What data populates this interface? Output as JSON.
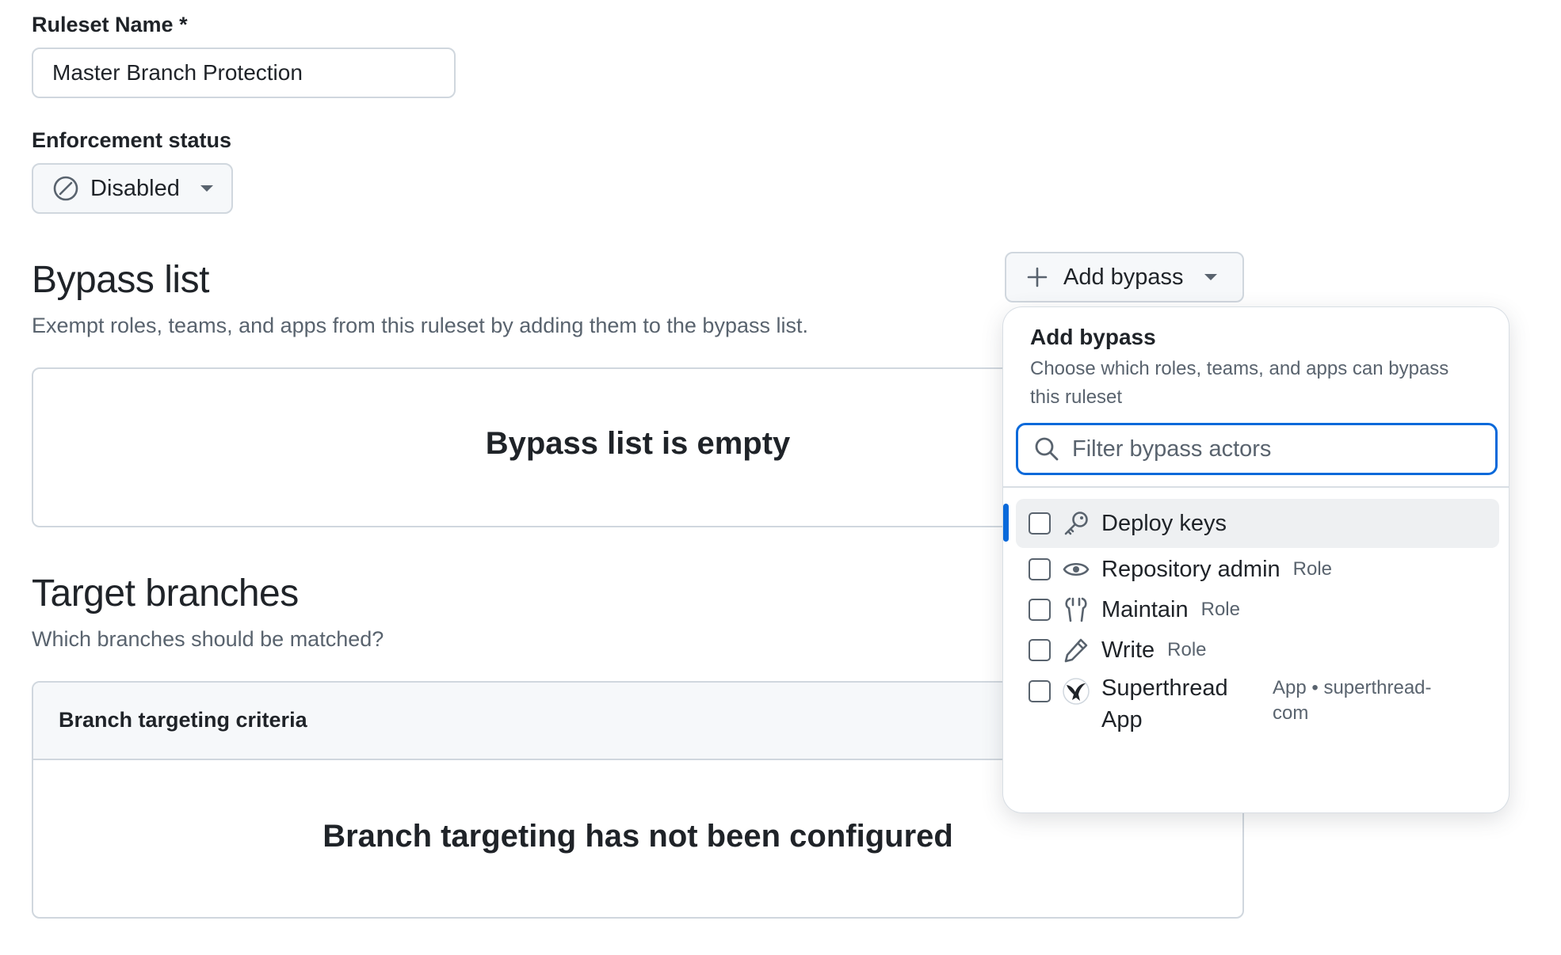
{
  "ruleset": {
    "name_label": "Ruleset Name *",
    "name_value": "Master Branch Protection"
  },
  "enforcement": {
    "label": "Enforcement status",
    "value": "Disabled"
  },
  "bypass": {
    "title": "Bypass list",
    "description": "Exempt roles, teams, and apps from this ruleset by adding them to the bypass list.",
    "add_button_label": "Add bypass",
    "empty_text": "Bypass list is empty"
  },
  "target": {
    "title": "Target branches",
    "description": "Which branches should be matched?",
    "criteria_header": "Branch targeting criteria",
    "empty_text": "Branch targeting has not been configured"
  },
  "popover": {
    "title": "Add bypass",
    "description": "Choose which roles, teams, and apps can bypass this ruleset",
    "filter_placeholder": "Filter bypass actors",
    "items": [
      {
        "label": "Deploy keys",
        "tag": "",
        "icon": "key-icon",
        "checked": false,
        "active": true
      },
      {
        "label": "Repository admin",
        "tag": "Role",
        "icon": "eye-icon",
        "checked": false,
        "active": false
      },
      {
        "label": "Maintain",
        "tag": "Role",
        "icon": "tools-icon",
        "checked": false,
        "active": false
      },
      {
        "label": "Write",
        "tag": "Role",
        "icon": "pencil-icon",
        "checked": false,
        "active": false
      },
      {
        "label": "Superthread App",
        "tag": "App • superthread-com",
        "icon": "superthread-app-icon",
        "checked": false,
        "active": false
      }
    ]
  },
  "colors": {
    "accent": "#0969da",
    "focus_border": "#0969da",
    "muted_text": "#59636e",
    "border": "#d0d7de",
    "button_bg": "#f6f8fa"
  }
}
